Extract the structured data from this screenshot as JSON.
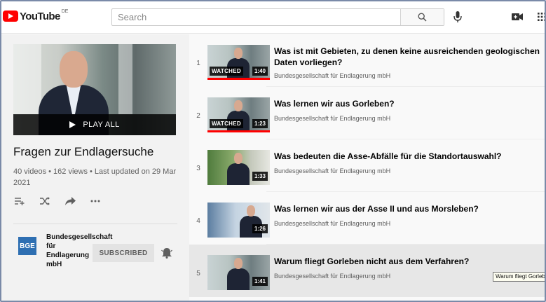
{
  "header": {
    "logo_text": "YouTube",
    "region": "DE",
    "search_placeholder": "Search"
  },
  "playlist": {
    "play_all_label": "PLAY ALL",
    "title": "Fragen zur Endlagersuche",
    "meta": "40 videos • 162 views • Last updated on 29 Mar 2021",
    "channel": {
      "avatar_text": "BGE",
      "name": "Bundesgesellschaft für Endlagerung mbH",
      "subscribe_label": "SUBSCRIBED"
    }
  },
  "videos": [
    {
      "index": "1",
      "title": "Was ist mit Gebieten, zu denen keine ausreichenden geologischen Daten vorliegen?",
      "channel": "Bundesgesellschaft für Endlagerung mbH",
      "duration": "1:40",
      "watched_label": "WATCHED",
      "watched_progress": 1.0
    },
    {
      "index": "2",
      "title": "Was lernen wir aus Gorleben?",
      "channel": "Bundesgesellschaft für Endlagerung mbH",
      "duration": "1:23",
      "watched_label": "WATCHED",
      "watched_progress": 1.0
    },
    {
      "index": "3",
      "title": "Was bedeuten die Asse-Abfälle für die Standortauswahl?",
      "channel": "Bundesgesellschaft für Endlagerung mbH",
      "duration": "1:33"
    },
    {
      "index": "4",
      "title": "Was lernen wir aus der Asse II und aus Morsleben?",
      "channel": "Bundesgesellschaft für Endlagerung mbH",
      "duration": "1:26"
    },
    {
      "index": "5",
      "title": "Warum fliegt Gorleben nicht aus dem Verfahren?",
      "channel": "Bundesgesellschaft für Endlagerung mbH",
      "duration": "1:41"
    }
  ],
  "tooltip": "Warum fliegt Gorleben nicht aus dem Verfahren?",
  "colors": {
    "brand_red": "#ff0000",
    "bge_blue": "#2e6fb2"
  },
  "icons": [
    "youtube-logo-icon",
    "search-icon",
    "mic-icon",
    "create-video-icon",
    "apps-grid-icon",
    "play-icon",
    "add-to-queue-icon",
    "shuffle-icon",
    "share-icon",
    "more-icon",
    "bell-icon"
  ]
}
